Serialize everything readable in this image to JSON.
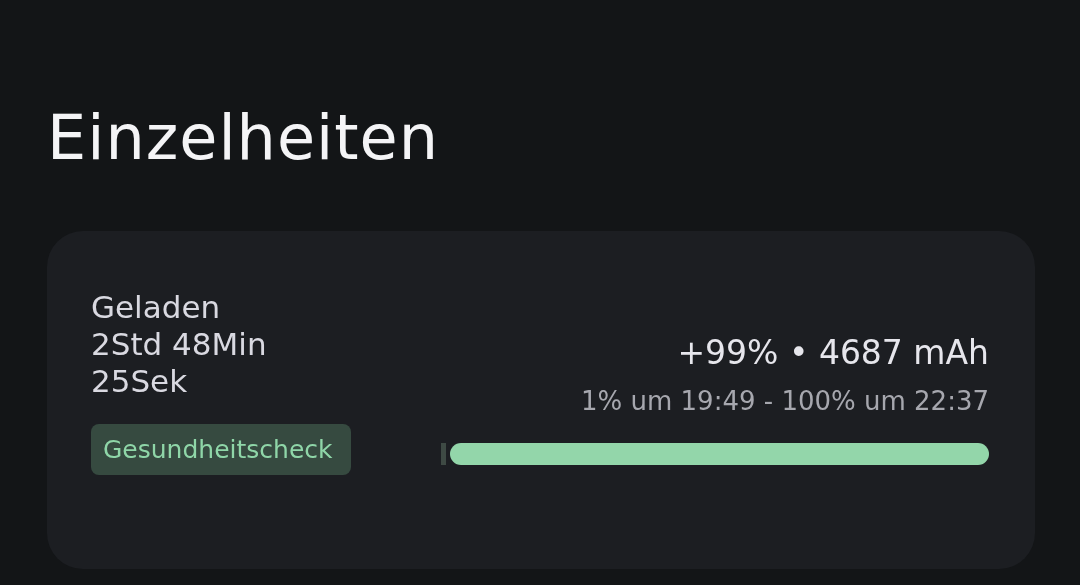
{
  "title": "Einzelheiten",
  "card": {
    "status_lines": [
      "Geladen",
      "2Std 48Min",
      "25Sek"
    ],
    "health_button": "Gesundheitscheck",
    "summary": "+99% • 4687 mAh",
    "range": "1% um 19:49 - 100% um 22:37",
    "charge": {
      "level": 0.99
    }
  }
}
